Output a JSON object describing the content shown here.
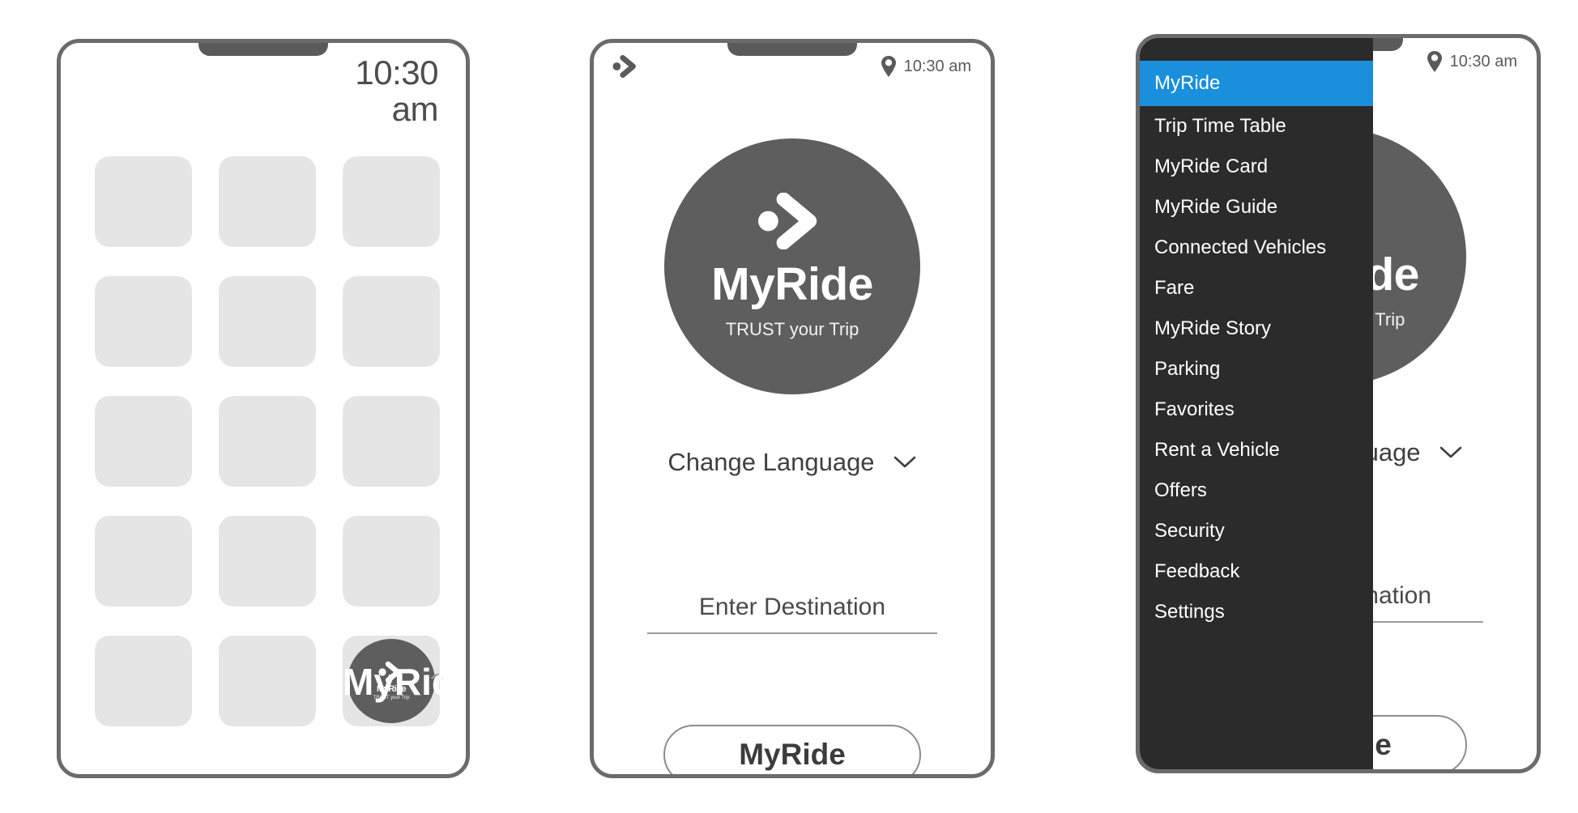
{
  "brand": {
    "name": "MyRide",
    "tagline": "TRUST your Trip",
    "logo_glyph": "chevron-dot-icon",
    "accent_color": "#1a8fdc",
    "logo_bg": "#5e5e5e",
    "tile_color": "#e5e5e5",
    "drawer_bg": "#2b2b2b"
  },
  "phone1": {
    "name": "home-screen-app-grid",
    "clock": "10:30 am",
    "clock_line1": "10:30",
    "clock_line2": "am",
    "app_icon_label": "MyRide",
    "expand_chevron": "⌃",
    "tiles": [
      {
        "id": 1,
        "label": ""
      },
      {
        "id": 2,
        "label": ""
      },
      {
        "id": 3,
        "label": ""
      },
      {
        "id": 4,
        "label": ""
      },
      {
        "id": 5,
        "label": ""
      },
      {
        "id": 6,
        "label": ""
      },
      {
        "id": 7,
        "label": ""
      },
      {
        "id": 8,
        "label": ""
      },
      {
        "id": 9,
        "label": ""
      },
      {
        "id": 10,
        "label": ""
      },
      {
        "id": 11,
        "label": ""
      },
      {
        "id": 12,
        "label": ""
      },
      {
        "id": 13,
        "label": ""
      },
      {
        "id": 14,
        "label": ""
      }
    ]
  },
  "phone2": {
    "name": "myride-splash-screen",
    "statusbar": {
      "brandmark_icon": "chevron-dot-icon",
      "location_icon": "map-pin-icon",
      "clock": "10:30 am"
    },
    "logo_title": "MyRide",
    "logo_tagline": "TRUST your Trip",
    "change_language_label": "Change Language",
    "change_language_icon": "chevron-down-icon",
    "destination_placeholder": "Enter Destination",
    "primary_button_label": "MyRide"
  },
  "phone3": {
    "name": "myride-screen-with-navigation-drawer",
    "statusbar": {
      "location_icon": "map-pin-icon",
      "clock": "10:30 am"
    },
    "logo_title": "MyRide",
    "logo_tagline": "TRUST your Trip",
    "change_language_label": "Change Language",
    "change_language_icon": "chevron-down-icon",
    "destination_placeholder": "Enter Destination",
    "primary_button_label": "MyRide",
    "drawer": {
      "active_index": 0,
      "items": [
        {
          "label": "MyRide",
          "active": true
        },
        {
          "label": "Trip Time Table",
          "active": false
        },
        {
          "label": "MyRide Card",
          "active": false
        },
        {
          "label": "MyRide Guide",
          "active": false
        },
        {
          "label": "Connected Vehicles",
          "active": false
        },
        {
          "label": "Fare",
          "active": false
        },
        {
          "label": "MyRide Story",
          "active": false
        },
        {
          "label": "Parking",
          "active": false
        },
        {
          "label": "Favorites",
          "active": false
        },
        {
          "label": "Rent a Vehicle",
          "active": false
        },
        {
          "label": "Offers",
          "active": false
        },
        {
          "label": "Security",
          "active": false
        },
        {
          "label": "Feedback",
          "active": false
        },
        {
          "label": "Settings",
          "active": false
        }
      ]
    }
  }
}
